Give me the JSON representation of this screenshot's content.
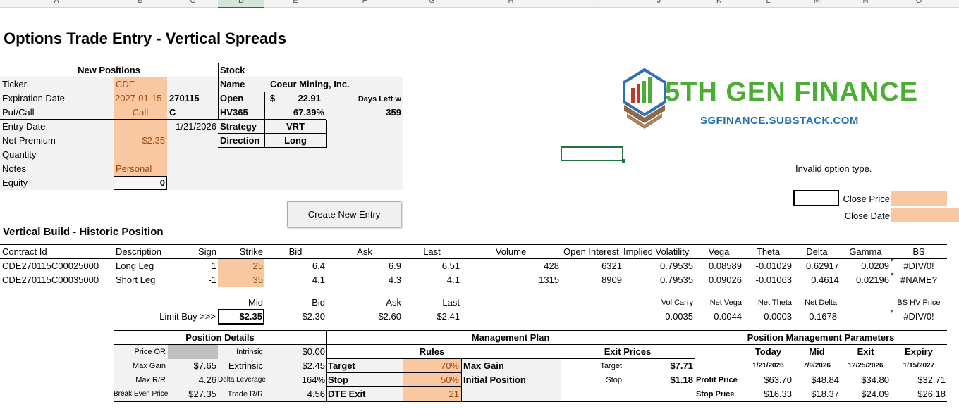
{
  "columns": [
    "A",
    "B",
    "C",
    "D",
    "E",
    "F",
    "G",
    "H",
    "I",
    "J",
    "K",
    "L",
    "M",
    "N",
    "O"
  ],
  "title": "Options Trade Entry - Vertical Spreads",
  "new_positions": {
    "header": "New Positions",
    "ticker_label": "Ticker",
    "ticker": "CDE",
    "exp_label": "Expiration Date",
    "exp": "2027-01-15",
    "exp_code": "270115",
    "pc_label": "Put/Call",
    "pc": "Call",
    "pc_code": "C",
    "entry_label": "Entry Date",
    "entry_date": "1/21/2026",
    "premium_label": "Net Premium",
    "premium": "$2.35",
    "qty_label": "Quantity",
    "notes_label": "Notes",
    "notes": "Personal",
    "equity_label": "Equity",
    "equity": "0"
  },
  "stock": {
    "header": "Stock",
    "name_label": "Name",
    "name": "Coeur Mining, Inc.",
    "open_label": "Open",
    "open_cur": "$",
    "open": "22.91",
    "days_label": "Days Left w",
    "days": "359",
    "hv_label": "HV365",
    "hv": "67.39%",
    "strategy_label": "Strategy",
    "strategy": "VRT",
    "direction_label": "Direction",
    "direction": "Long"
  },
  "logo": {
    "name": "5TH GEN FINANCE",
    "url": "SGFINANCE.SUBSTACK.COM"
  },
  "invalid_msg": "Invalid option type.",
  "close_price_label": "Close Price",
  "close_date_label": "Close Date",
  "button": "Create New Entry",
  "vb_title": "Vertical Build - Historic Position",
  "legs": {
    "headers": [
      "Contract Id",
      "Description",
      "Sign",
      "Strike",
      "Bid",
      "Ask",
      "Last",
      "Volume",
      "Open Interest",
      "Implied Volatility",
      "Vega",
      "Theta",
      "Delta",
      "Gamma",
      "BS"
    ],
    "rows": [
      [
        "CDE270115C00025000",
        "Long Leg",
        "1",
        "25",
        "6.4",
        "6.9",
        "6.51",
        "428",
        "6321",
        "0.79535",
        "0.08589",
        "-0.01029",
        "0.62917",
        "0.0209",
        "#DIV/0!"
      ],
      [
        "CDE270115C00035000",
        "Short Leg",
        "-1",
        "35",
        "4.1",
        "4.3",
        "4.1",
        "1315",
        "8909",
        "0.79535",
        "0.09026",
        "-0.01063",
        "0.4614",
        "0.02196",
        "#NAME?"
      ]
    ]
  },
  "limit": {
    "headers": {
      "mid": "Mid",
      "bid": "Bid",
      "ask": "Ask",
      "last": "Last",
      "vc": "Vol Carry",
      "nv": "Net Vega",
      "nt": "Net Theta",
      "nd": "Net Delta",
      "bshv": "BS HV Price"
    },
    "label": "Limit Buy >>>",
    "mid": "$2.35",
    "bid": "$2.30",
    "ask": "$2.60",
    "last": "$2.41",
    "vc": "-0.0035",
    "nv": "-0.0044",
    "nt": "0.0003",
    "nd": "0.1678",
    "bshv": "#DIV/0!"
  },
  "pos_details": {
    "header": "Position Details",
    "price_or": "Price OR",
    "intrinsic_label": "Intrinsic",
    "intrinsic": "$0.00",
    "max_gain_label": "Max Gain",
    "max_gain": "$7.65",
    "extrinsic_label": "Extrinsic",
    "extrinsic": "$2.45",
    "max_rr_label": "Max R/R",
    "max_rr": "4.26",
    "delta_lev_label": "Delta Leverage",
    "delta_lev": "164%",
    "be_label": "Break Even Price",
    "be": "$27.35",
    "trade_rr_label": "Trade R/R",
    "trade_rr": "4.56"
  },
  "mgmt": {
    "header": "Management Plan",
    "rules": "Rules",
    "exit_prices": "Exit Prices",
    "target_label": "Target",
    "target_pct": "70%",
    "max_gain_label": "Max Gain",
    "target_exit_label": "Target",
    "target_exit": "$7.71",
    "stop_label": "Stop",
    "stop_pct": "50%",
    "init_pos_label": "Initial Position",
    "stop_exit_label": "Stop",
    "stop_exit": "$1.18",
    "dte_label": "DTE Exit",
    "dte": "21"
  },
  "pmp": {
    "header": "Position Management Parameters",
    "cols": [
      "Today",
      "Mid",
      "Exit",
      "Expiry"
    ],
    "dates": [
      "1/21/2026",
      "7/9/2026",
      "12/25/2026",
      "1/15/2027"
    ],
    "profit_label": "Profit Price",
    "profit": [
      "$63.70",
      "$48.84",
      "$34.80",
      "$32.71"
    ],
    "stop_label": "Stop Price",
    "stop": [
      "$16.33",
      "$18.37",
      "$24.09",
      "$26.18"
    ]
  }
}
